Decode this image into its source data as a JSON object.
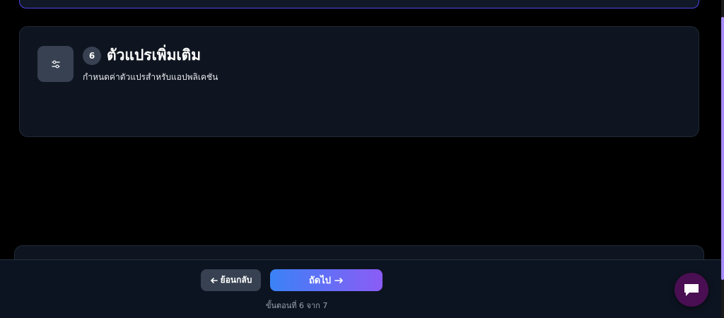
{
  "step": {
    "number": "6",
    "title": "ตัวแปรเพิ่มเติม",
    "subtitle": "กำหนดค่าตัวแปรสำหรับแอปพลิเคชัน",
    "icon": "sliders-icon"
  },
  "navigation": {
    "back_label": "ย้อนกลับ",
    "next_label": "ถัดไป",
    "back_icon": "arrow-left-icon",
    "next_icon": "arrow-right-icon",
    "step_indicator": "ขั้นตอนที่ 6 จาก 7"
  },
  "chat": {
    "icon": "chat-bubble-icon"
  },
  "colors": {
    "background": "#000000",
    "card": "#0f1520",
    "accent_border": "#4f46e5",
    "button_gradient_start": "#3b82f6",
    "button_gradient_end": "#8b5cf6",
    "chat_button": "#4a0e52",
    "scrollbar": "#a78bfa"
  }
}
